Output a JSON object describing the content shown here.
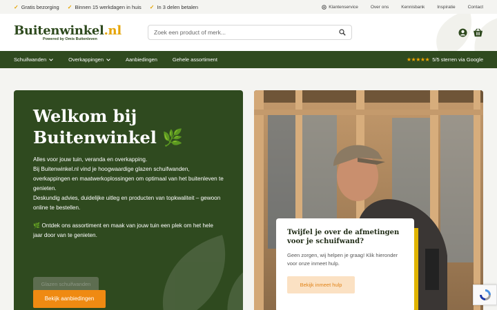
{
  "topbar": {
    "usps": [
      "Gratis bezorging",
      "Binnen 15 werkdagen in huis",
      "In 3 delen betalen"
    ],
    "links": [
      "Klantenservice",
      "Over ons",
      "Kennisbank",
      "Inspiratie",
      "Contact"
    ]
  },
  "header": {
    "logo_main": "Buitenwinkel",
    "logo_dot": ".nl",
    "logo_sub": "Powered by Omis Buitenleven",
    "search_placeholder": "Zoek een product of merk..."
  },
  "nav": {
    "items": [
      {
        "label": "Schuifwanden",
        "dropdown": true
      },
      {
        "label": "Overkappingen",
        "dropdown": true
      },
      {
        "label": "Aanbiedingen",
        "dropdown": false
      },
      {
        "label": "Gehele assortiment",
        "dropdown": false
      }
    ],
    "rating_stars": "★★★★★",
    "rating_text": "5/5 sterren via Google"
  },
  "hero": {
    "title": "Welkom bij Buitenwinkel 🌿",
    "lines": [
      "Alles voor jouw tuin, veranda en overkapping.",
      "Bij Buitenwinkel.nl vind je hoogwaardige glazen schuifwanden, overkappingen en maatwerkoplossingen om optimaal van het buitenleven te genieten.",
      "Deskundig advies, duidelijke uitleg en producten van topkwaliteit – gewoon online te bestellen."
    ],
    "cta_text": "🌿 Ontdek ons assortiment en maak van jouw tuin een plek om het hele jaar door van te genieten.",
    "ghost_button": "Glazen schuifwanden",
    "orange_button": "Bekijk aanbiedingen"
  },
  "card": {
    "title": "Twijfel je over de afmetingen voor je schuifwand?",
    "text": "Geen zorgen, wij helpen je graag! Klik hieronder voor onze inmeet hulp.",
    "button": "Bekijk inmeet hulp"
  },
  "colors": {
    "brand_green": "#2f4a1f",
    "accent_orange": "#ef8a12",
    "check_yellow": "#e5a400"
  }
}
